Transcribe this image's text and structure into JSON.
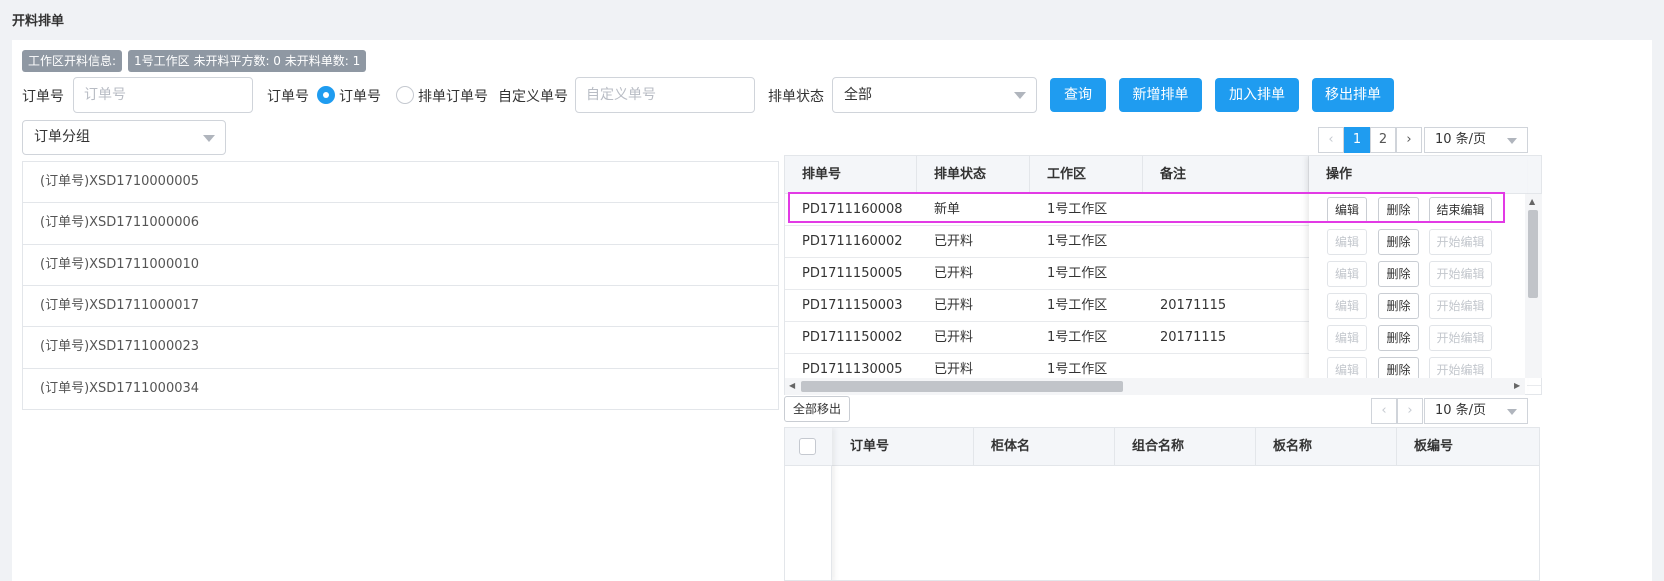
{
  "page": {
    "title": "开料排单"
  },
  "info": {
    "label": "工作区开料信息:",
    "detail": "1号工作区 未开料平方数: 0 未开料单数: 1"
  },
  "filters": {
    "order_no_label": "订单号",
    "order_no_placeholder": "订单号",
    "type_label": "订单号",
    "radio_order": "订单号",
    "radio_schedule": "排单订单号",
    "custom_label": "自定义单号",
    "custom_placeholder": "自定义单号",
    "status_label": "排单状态",
    "status_value": "全部"
  },
  "actions": {
    "query": "查询",
    "add_schedule": "新增排单",
    "join_schedule": "加入排单",
    "remove_schedule": "移出排单"
  },
  "group_select": {
    "value": "订单分组"
  },
  "order_list": [
    "(订单号)XSD1710000005",
    "(订单号)XSD1711000006",
    "(订单号)XSD1711000010",
    "(订单号)XSD1711000017",
    "(订单号)XSD1711000023",
    "(订单号)XSD1711000034"
  ],
  "pager_top": {
    "prev": "‹",
    "pages": [
      "1",
      "2"
    ],
    "next": "›",
    "size": "10 条/页"
  },
  "schedule_table": {
    "headers": [
      "排单号",
      "排单状态",
      "工作区",
      "备注",
      "操作"
    ],
    "rows": [
      {
        "no": "PD1711160008",
        "status": "新单",
        "zone": "1号工作区",
        "note": "",
        "edit": "编辑",
        "del": "删除",
        "toggle": "结束编辑",
        "editable": true
      },
      {
        "no": "PD1711160002",
        "status": "已开料",
        "zone": "1号工作区",
        "note": "",
        "edit": "编辑",
        "del": "删除",
        "toggle": "开始编辑",
        "editable": false
      },
      {
        "no": "PD1711150005",
        "status": "已开料",
        "zone": "1号工作区",
        "note": "",
        "edit": "编辑",
        "del": "删除",
        "toggle": "开始编辑",
        "editable": false
      },
      {
        "no": "PD1711150003",
        "status": "已开料",
        "zone": "1号工作区",
        "note": "20171115",
        "edit": "编辑",
        "del": "删除",
        "toggle": "开始编辑",
        "editable": false
      },
      {
        "no": "PD1711150002",
        "status": "已开料",
        "zone": "1号工作区",
        "note": "20171115",
        "edit": "编辑",
        "del": "删除",
        "toggle": "开始编辑",
        "editable": false
      },
      {
        "no": "PD1711130005",
        "status": "已开料",
        "zone": "1号工作区",
        "note": "",
        "edit": "编辑",
        "del": "删除",
        "toggle": "开始编辑",
        "editable": false
      }
    ]
  },
  "remove_all": "全部移出",
  "pager_bottom": {
    "prev": "‹",
    "next": "›",
    "size": "10 条/页"
  },
  "detail_table": {
    "headers": [
      "订单号",
      "柜体名",
      "组合名称",
      "板名称",
      "板编号"
    ]
  },
  "colors": {
    "primary": "#1f9cf0",
    "highlight": "#e23ae5",
    "tag": "#8f98a3"
  }
}
